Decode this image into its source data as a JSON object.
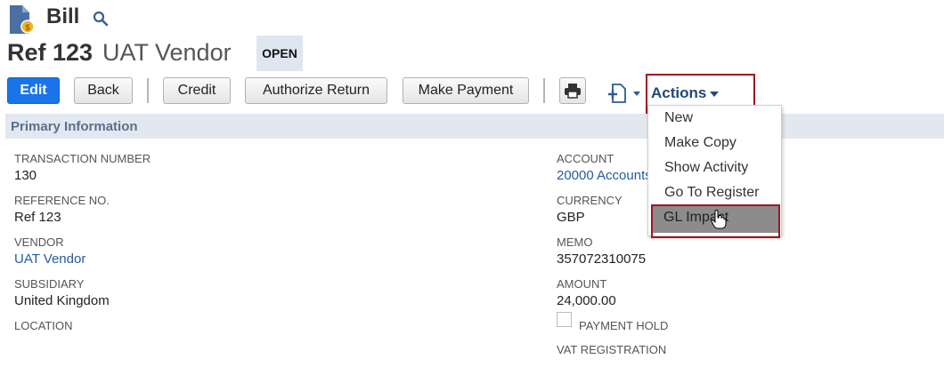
{
  "header": {
    "record_type": "Bill",
    "ref": "Ref 123",
    "vendor": "UAT Vendor",
    "status": "OPEN"
  },
  "toolbar": {
    "edit": "Edit",
    "back": "Back",
    "credit": "Credit",
    "authorize_return": "Authorize Return",
    "make_payment": "Make Payment",
    "actions": "Actions"
  },
  "section": {
    "title": "Primary Information"
  },
  "fields": {
    "transaction_number_label": "TRANSACTION NUMBER",
    "transaction_number": "130",
    "reference_no_label": "REFERENCE NO.",
    "reference_no": "Ref 123",
    "vendor_label": "VENDOR",
    "vendor": "UAT Vendor",
    "subsidiary_label": "SUBSIDIARY",
    "subsidiary": "United Kingdom",
    "location_label": "LOCATION",
    "account_label": "ACCOUNT",
    "account": "20000 Accounts",
    "currency_label": "CURRENCY",
    "currency": "GBP",
    "memo_label": "MEMO",
    "memo": "357072310075",
    "amount_label": "AMOUNT",
    "amount": "24,000.00",
    "payment_hold_label": "PAYMENT HOLD",
    "vat_registration_label": "VAT REGISTRATION"
  },
  "actions_menu": {
    "items": [
      "New",
      "Make Copy",
      "Show Activity",
      "Go To Register",
      "GL Impact"
    ]
  },
  "colors": {
    "primary": "#1a73e8",
    "link": "#255aa0",
    "highlight_box": "#a01620",
    "section_bar": "#e3e8f0"
  }
}
